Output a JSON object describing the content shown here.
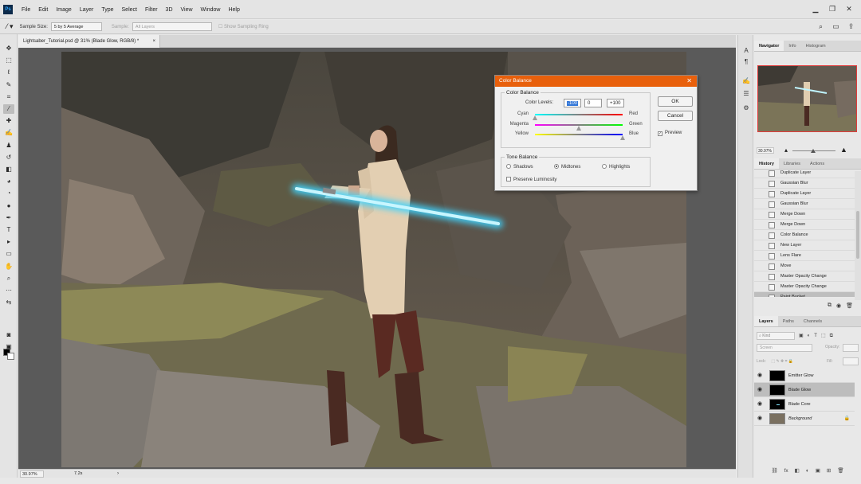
{
  "app": {
    "logo_text": "Ps"
  },
  "menu": [
    "File",
    "Edit",
    "Image",
    "Layer",
    "Type",
    "Select",
    "Filter",
    "3D",
    "View",
    "Window",
    "Help"
  ],
  "window_controls": {
    "minimize": "▁",
    "restore": "❐",
    "close": "✕"
  },
  "options_bar": {
    "sample_size_label": "Sample Size:",
    "sample_size_value": "5 by 5 Average",
    "sample_label": "Sample:",
    "sample_value": "All Layers",
    "show_ring_label": "Show Sampling Ring",
    "icons": {
      "search": "⌕",
      "workspace": "▭",
      "share": "⇪"
    }
  },
  "document": {
    "tab_title": "Lightsaber_Tutorial.psd @ 31% (Blade Glow, RGB/8) *",
    "tab_close": "×"
  },
  "status": {
    "zoom": "30.97%",
    "info": "7.2s",
    "arrow": "›"
  },
  "tools": [
    {
      "name": "move-tool-icon",
      "glyph": "✥"
    },
    {
      "name": "marquee-tool-icon",
      "glyph": "⬚"
    },
    {
      "name": "lasso-tool-icon",
      "glyph": "ℓ"
    },
    {
      "name": "quick-select-tool-icon",
      "glyph": "✎"
    },
    {
      "name": "crop-tool-icon",
      "glyph": "⌗"
    },
    {
      "name": "eyedropper-tool-icon",
      "glyph": "⁄"
    },
    {
      "name": "healing-brush-tool-icon",
      "glyph": "✚"
    },
    {
      "name": "brush-tool-icon",
      "glyph": "✍"
    },
    {
      "name": "clone-stamp-tool-icon",
      "glyph": "♟"
    },
    {
      "name": "history-brush-tool-icon",
      "glyph": "↺"
    },
    {
      "name": "eraser-tool-icon",
      "glyph": "◧"
    },
    {
      "name": "paint-bucket-tool-icon",
      "glyph": "◕"
    },
    {
      "name": "blur-tool-icon",
      "glyph": "◔"
    },
    {
      "name": "dodge-tool-icon",
      "glyph": "●"
    },
    {
      "name": "pen-tool-icon",
      "glyph": "✒"
    },
    {
      "name": "type-tool-icon",
      "glyph": "T"
    },
    {
      "name": "path-select-tool-icon",
      "glyph": "▸"
    },
    {
      "name": "shape-tool-icon",
      "glyph": "▭"
    },
    {
      "name": "hand-tool-icon",
      "glyph": "✋"
    },
    {
      "name": "zoom-tool-icon",
      "glyph": "⌕"
    },
    {
      "name": "edit-toolbar-icon",
      "glyph": "⋯"
    },
    {
      "name": "swap-colors-icon",
      "glyph": "⇆"
    }
  ],
  "tools_bottom": [
    {
      "name": "quick-mask-icon",
      "glyph": "◙"
    },
    {
      "name": "screen-mode-icon",
      "glyph": "▣"
    }
  ],
  "dock_icons": [
    {
      "name": "character-panel-icon",
      "glyph": "A"
    },
    {
      "name": "paragraph-panel-icon",
      "glyph": "¶"
    },
    {
      "name": "brush-settings-icon",
      "glyph": "✍"
    },
    {
      "name": "properties-panel-icon",
      "glyph": "☰"
    },
    {
      "name": "adjustments-panel-icon",
      "glyph": "⚙"
    }
  ],
  "navigator": {
    "tabs": [
      "Navigator",
      "Info",
      "Histogram"
    ],
    "zoom": "30.97%"
  },
  "history": {
    "tabs": [
      "History",
      "Libraries",
      "Actions"
    ],
    "items": [
      "Duplicate Layer",
      "Gaussian Blur",
      "Duplicate Layer",
      "Gaussian Blur",
      "Merge Down",
      "Merge Down",
      "Color Balance",
      "New Layer",
      "Lens Flare",
      "Move",
      "Master Opacity Change",
      "Master Opacity Change",
      "Paint Bucket"
    ],
    "footer_icons": [
      "⧉",
      "◉",
      "🗑"
    ]
  },
  "layers": {
    "tabs": [
      "Layers",
      "Paths",
      "Channels"
    ],
    "filter_kind": "⌕ Kind",
    "filter_icons": [
      "▣",
      "◐",
      "T",
      "⬚",
      "⧉"
    ],
    "blend_mode": "Screen",
    "opacity_label": "Opacity:",
    "lock_label": "Lock:",
    "lock_icons": "⬚ ✎ ✥ ⌗ 🔒",
    "fill_label": "Fill:",
    "items": [
      {
        "name": "Emitter Glow",
        "selected": false,
        "locked": false
      },
      {
        "name": "Blade Glow",
        "selected": true,
        "locked": false
      },
      {
        "name": "Blade Core",
        "selected": false,
        "locked": false
      },
      {
        "name": "Background",
        "selected": false,
        "locked": true
      }
    ],
    "eye_glyph": "◉",
    "lock_glyph": "🔒",
    "footer_icons": [
      "⛓",
      "fx",
      "◧",
      "◐",
      "▣",
      "⊞",
      "🗑"
    ]
  },
  "dialog": {
    "title": "Color Balance",
    "close": "✕",
    "group_title": "Color Balance",
    "levels_label": "Color Levels:",
    "levels": [
      "-100",
      "0",
      "+100"
    ],
    "sliders": [
      {
        "left": "Cyan",
        "right": "Red",
        "value": -100,
        "gradient": "linear-gradient(to right,#00ffff,#ff0000)"
      },
      {
        "left": "Magenta",
        "right": "Green",
        "value": 0,
        "gradient": "linear-gradient(to right,#ff00ff,#00ff00)"
      },
      {
        "left": "Yellow",
        "right": "Blue",
        "value": 100,
        "gradient": "linear-gradient(to right,#ffff00,#0000ff)"
      }
    ],
    "tone_title": "Tone Balance",
    "tones": [
      {
        "label": "Shadows",
        "checked": false
      },
      {
        "label": "Midtones",
        "checked": true
      },
      {
        "label": "Highlights",
        "checked": false
      }
    ],
    "preserve_luminosity": "Preserve Luminosity",
    "preserve_checked": false,
    "ok": "OK",
    "cancel": "Cancel",
    "preview": "Preview",
    "preview_checked": true,
    "check_glyph": "✓"
  },
  "colors": {
    "accent": "#e8600c",
    "nav_frame": "#e23b3b",
    "saber": "#7fe6ff"
  }
}
